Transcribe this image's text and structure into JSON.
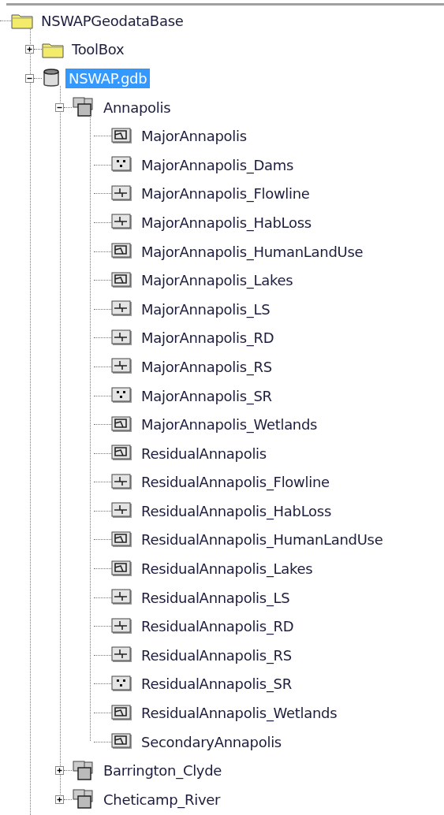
{
  "tree": [
    {
      "label": "NSWAPGeodataBase",
      "kind": "folder",
      "selected": false,
      "children": [
        {
          "label": "ToolBox",
          "kind": "folder",
          "selected": false,
          "expanded": false
        },
        {
          "label": "NSWAP.gdb",
          "kind": "database",
          "selected": true,
          "expanded": true,
          "children": [
            {
              "label": "Annapolis",
              "kind": "dataset",
              "selected": false,
              "expanded": true,
              "children": [
                {
                  "label": "MajorAnnapolis",
                  "kind": "polygon",
                  "selected": false
                },
                {
                  "label": "MajorAnnapolis_Dams",
                  "kind": "point",
                  "selected": false
                },
                {
                  "label": "MajorAnnapolis_Flowline",
                  "kind": "line",
                  "selected": false
                },
                {
                  "label": "MajorAnnapolis_HabLoss",
                  "kind": "line",
                  "selected": false
                },
                {
                  "label": "MajorAnnapolis_HumanLandUse",
                  "kind": "polygon",
                  "selected": false
                },
                {
                  "label": "MajorAnnapolis_Lakes",
                  "kind": "polygon",
                  "selected": false
                },
                {
                  "label": "MajorAnnapolis_LS",
                  "kind": "line",
                  "selected": false
                },
                {
                  "label": "MajorAnnapolis_RD",
                  "kind": "line",
                  "selected": false
                },
                {
                  "label": "MajorAnnapolis_RS",
                  "kind": "line",
                  "selected": false
                },
                {
                  "label": "MajorAnnapolis_SR",
                  "kind": "point",
                  "selected": false
                },
                {
                  "label": "MajorAnnapolis_Wetlands",
                  "kind": "polygon",
                  "selected": false
                },
                {
                  "label": "ResidualAnnapolis",
                  "kind": "polygon",
                  "selected": false
                },
                {
                  "label": "ResidualAnnapolis_Flowline",
                  "kind": "line",
                  "selected": false
                },
                {
                  "label": "ResidualAnnapolis_HabLoss",
                  "kind": "line",
                  "selected": false
                },
                {
                  "label": "ResidualAnnapolis_HumanLandUse",
                  "kind": "polygon",
                  "selected": false
                },
                {
                  "label": "ResidualAnnapolis_Lakes",
                  "kind": "polygon",
                  "selected": false
                },
                {
                  "label": "ResidualAnnapolis_LS",
                  "kind": "line",
                  "selected": false
                },
                {
                  "label": "ResidualAnnapolis_RD",
                  "kind": "line",
                  "selected": false
                },
                {
                  "label": "ResidualAnnapolis_RS",
                  "kind": "line",
                  "selected": false
                },
                {
                  "label": "ResidualAnnapolis_SR",
                  "kind": "point",
                  "selected": false
                },
                {
                  "label": "ResidualAnnapolis_Wetlands",
                  "kind": "polygon",
                  "selected": false
                },
                {
                  "label": "SecondaryAnnapolis",
                  "kind": "polygon",
                  "selected": false
                }
              ]
            },
            {
              "label": "Barrington_Clyde",
              "kind": "dataset",
              "selected": false,
              "expanded": false
            },
            {
              "label": "Cheticamp_River",
              "kind": "dataset",
              "selected": false,
              "expanded": false
            }
          ]
        }
      ]
    }
  ]
}
